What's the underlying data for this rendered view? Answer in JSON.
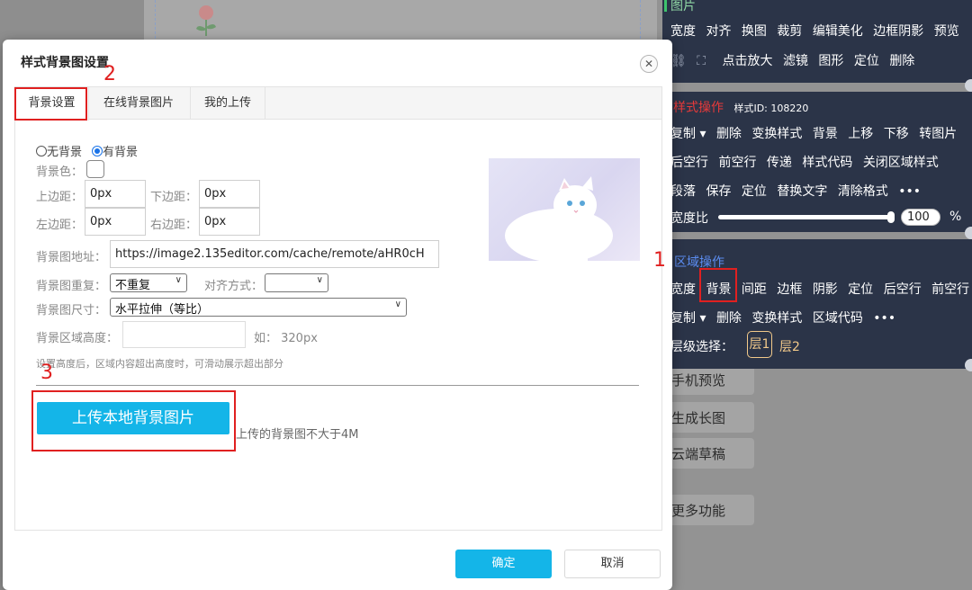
{
  "dialog": {
    "title": "样式背景图设置",
    "close_icon": "close-icon",
    "tabs": [
      "背景设置",
      "在线背景图片",
      "我的上传"
    ],
    "radio_none": "无背景",
    "radio_has": "有背景",
    "bg_color_label": "背景色：",
    "top_margin_label": "上边距：",
    "top_margin_value": "0px",
    "bottom_margin_label": "下边距：",
    "bottom_margin_value": "0px",
    "left_margin_label": "左边距：",
    "left_margin_value": "0px",
    "right_margin_label": "右边距：",
    "right_margin_value": "0px",
    "image_url_label": "背景图地址：",
    "image_url_value": "https://image2.135editor.com/cache/remote/aHR0cH",
    "repeat_label": "背景图重复：",
    "repeat_value": "不重复",
    "align_label": "对齐方式：",
    "align_value": "",
    "size_label": "背景图尺寸：",
    "size_value": "水平拉伸（等比）",
    "area_height_label": "背景区域高度：",
    "area_height_hint": "如： 320px",
    "area_note": "设置高度后，区域内容超出高度时，可滑动展示超出部分",
    "upload_button": "上传本地背景图片",
    "upload_hint": "上传的背景图不大于4M",
    "confirm_button": "确定",
    "cancel_button": "取消"
  },
  "annotations": [
    "1",
    "2",
    "3"
  ],
  "side_buttons": [
    "手机预览",
    "生成长图",
    "云端草稿",
    "更多功能"
  ],
  "toolbar": {
    "image_section": {
      "title": "图片",
      "row1": [
        "宽度",
        "对齐",
        "换图",
        "裁剪",
        "编辑美化",
        "边框阴影",
        "预览"
      ],
      "row2": [
        "点击放大",
        "滤镜",
        "图形",
        "定位",
        "删除"
      ]
    },
    "style_section": {
      "title": "样式操作",
      "id_label": "样式ID: 108220",
      "row1": [
        "复制 ▾",
        "删除",
        "变换样式",
        "背景",
        "上移",
        "下移",
        "转图片"
      ],
      "row2": [
        "后空行",
        "前空行",
        "传递",
        "样式代码",
        "关闭区域样式"
      ],
      "row3": [
        "段落",
        "保存",
        "定位",
        "替换文字",
        "清除格式",
        "•••"
      ],
      "width_label": "宽度比",
      "width_value": "100",
      "width_unit": "%",
      "width_percent": 100
    },
    "area_section": {
      "title": "区域操作",
      "row1": [
        "宽度",
        "背景",
        "间距",
        "边框",
        "阴影",
        "定位",
        "后空行",
        "前空行"
      ],
      "row2": [
        "复制 ▾",
        "删除",
        "变换样式",
        "区域代码",
        "•••"
      ],
      "layer_label": "层级选择：",
      "layers": [
        "层1",
        "层2"
      ]
    }
  },
  "colors": {
    "accent": "#14b5e8",
    "annotation": "#e02020",
    "panel": "#2b3448",
    "style_title": "#e83a3a",
    "area_title": "#5b8cf0",
    "layer_active": "#f2c98a"
  }
}
